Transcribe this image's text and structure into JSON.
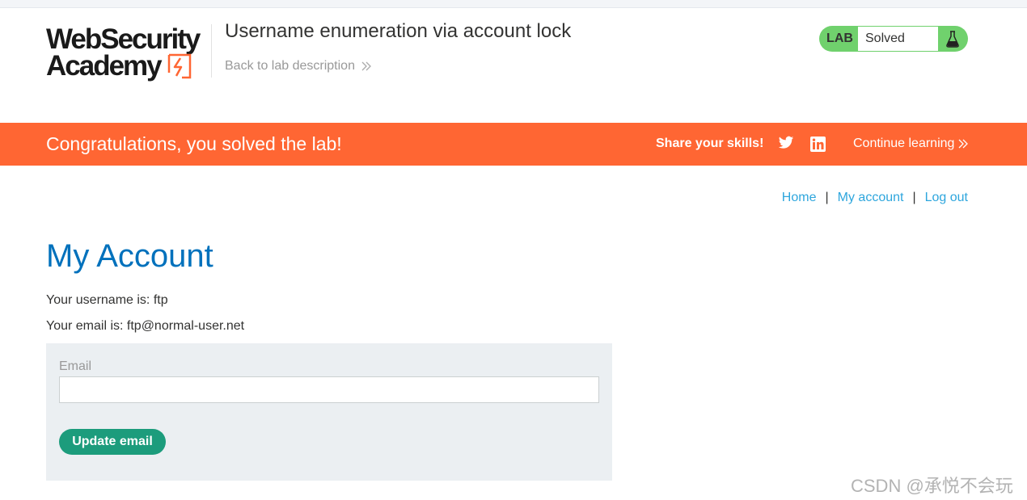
{
  "header": {
    "logo_line1": "WebSecurity",
    "logo_line2": "Academy",
    "lab_title": "Username enumeration via account lock",
    "back_link": "Back to lab description",
    "status_badge_label": "LAB",
    "status_text": "Solved",
    "status_color": "#70d16d"
  },
  "banner": {
    "message": "Congratulations, you solved the lab!",
    "share_label": "Share your skills!",
    "continue_label": "Continue learning",
    "color": "#ff6633"
  },
  "nav": {
    "home": "Home",
    "my_account": "My account",
    "logout": "Log out",
    "separator": "|"
  },
  "account": {
    "title": "My Account",
    "username_line": "Your username is: ftp",
    "email_line": "Your email is: ftp@normal-user.net"
  },
  "form": {
    "email_label": "Email",
    "email_value": "",
    "update_button": "Update email",
    "button_color": "#1c9c7c"
  },
  "watermark": "CSDN @承悦不会玩",
  "icons": {
    "logo_mark": "lightning-bracket-icon",
    "back_chevron": "double-chevron-right-icon",
    "status": "flask-icon",
    "twitter": "twitter-icon",
    "linkedin": "linkedin-icon",
    "continue_chevron": "double-chevron-right-icon"
  }
}
